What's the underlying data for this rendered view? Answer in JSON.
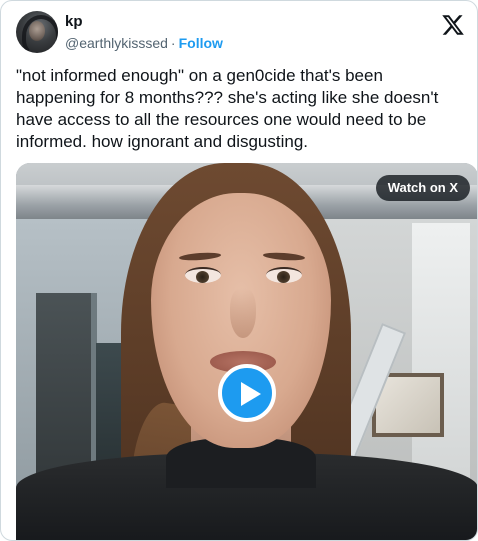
{
  "author": {
    "display_name": "kp",
    "handle": "@earthlykisssed",
    "separator": "·",
    "follow_label": "Follow",
    "avatar_icon": "profile-photo"
  },
  "platform_logo": "x-logo-icon",
  "tweet": {
    "text": "\"not informed enough\" on a gen0cide that's been happening for 8 months??? she's acting like she doesn't have access to all the resources one would need to be informed. how ignorant and disgusting."
  },
  "media": {
    "watch_label": "Watch on X",
    "play_icon": "play-icon"
  },
  "colors": {
    "accent": "#1d9bf0",
    "text": "#0f1419",
    "secondary_text": "#536471",
    "border": "#cfd9de"
  }
}
